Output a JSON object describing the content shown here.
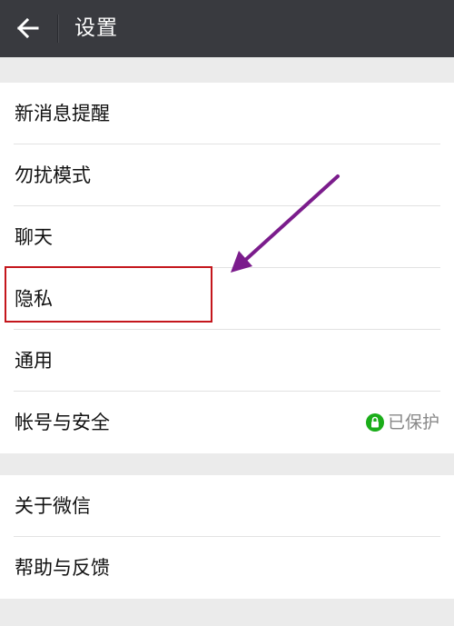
{
  "header": {
    "back_icon": "back-arrow-icon",
    "title": "设置"
  },
  "settings": {
    "group1": [
      {
        "label": "新消息提醒"
      },
      {
        "label": "勿扰模式"
      },
      {
        "label": "聊天"
      },
      {
        "label": "隐私"
      },
      {
        "label": "通用"
      },
      {
        "label": "帐号与安全",
        "status": "已保护",
        "status_icon": "lock-icon",
        "status_color": "#1aad19"
      }
    ],
    "group2": [
      {
        "label": "关于微信"
      },
      {
        "label": "帮助与反馈"
      }
    ]
  },
  "annotations": {
    "highlight_color": "#c4161c",
    "arrow_color": "#7b1c8c"
  },
  "colors": {
    "topbar": "#393a3f",
    "background": "#ebebeb"
  }
}
